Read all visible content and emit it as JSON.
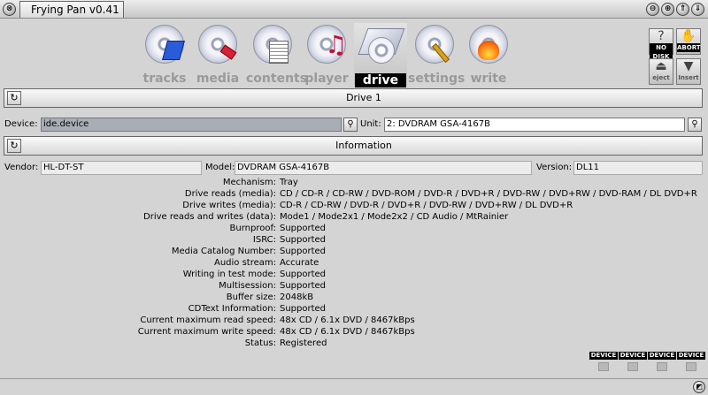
{
  "window": {
    "title": "Frying Pan v0.41"
  },
  "toolbar": {
    "tabs": [
      {
        "label": "tracks"
      },
      {
        "label": "media"
      },
      {
        "label": "contents"
      },
      {
        "label": "player"
      },
      {
        "label": "drive"
      },
      {
        "label": "settings"
      },
      {
        "label": "write"
      }
    ],
    "active": "drive",
    "buttons": {
      "no_disk": "NO DISK",
      "abort": "ABORT",
      "eject": "eject",
      "insert": "Insert"
    }
  },
  "drive_bar": {
    "title": "Drive 1"
  },
  "device": {
    "label": "Device:",
    "value": "ide.device"
  },
  "unit": {
    "label": "Unit:",
    "value": "2: DVDRAM GSA-4167B"
  },
  "info_bar": {
    "title": "Information"
  },
  "vendor": {
    "label": "Vendor:",
    "value": "HL-DT-ST"
  },
  "model": {
    "label": "Model:",
    "value": "DVDRAM GSA-4167B"
  },
  "version": {
    "label": "Version:",
    "value": "DL11"
  },
  "info_rows": [
    {
      "key": "Mechanism:",
      "value": "Tray"
    },
    {
      "key": "Drive reads (media):",
      "value": "CD / CD-R / CD-RW / DVD-ROM / DVD-R / DVD+R / DVD-RW / DVD+RW / DVD-RAM / DL DVD+R"
    },
    {
      "key": "Drive writes (media):",
      "value": "CD-R / CD-RW / DVD-R / DVD+R / DVD-RW / DVD+RW / DL DVD+R"
    },
    {
      "key": "Drive reads and writes (data):",
      "value": "Mode1 / Mode2x1 / Mode2x2 / CD Audio / MtRainier"
    },
    {
      "key": "Burnproof:",
      "value": "Supported"
    },
    {
      "key": "ISRC:",
      "value": "Supported"
    },
    {
      "key": "Media Catalog Number:",
      "value": "Supported"
    },
    {
      "key": "Audio stream:",
      "value": "Accurate"
    },
    {
      "key": "Writing in test mode:",
      "value": "Supported"
    },
    {
      "key": "Multisession:",
      "value": "Supported"
    },
    {
      "key": "Buffer size:",
      "value": "2048kB"
    },
    {
      "key": "CDText Information:",
      "value": "Supported"
    },
    {
      "key": "Current maximum read speed:",
      "value": "48x CD / 6.1x DVD / 8467kBps"
    },
    {
      "key": "Current maximum write speed:",
      "value": "48x CD / 6.1x DVD / 8467kBps"
    },
    {
      "key": "Status:",
      "value": "Registered"
    }
  ],
  "device_indicators": [
    "DEVICE",
    "DEVICE",
    "DEVICE",
    "DEVICE"
  ],
  "colors": {
    "active_tab_label_bg": "#000000",
    "inactive_label": "#9a9a9a",
    "device_field_bg": "#a8adb6"
  },
  "icons": {
    "close": "close-icon",
    "refresh": "refresh-icon",
    "popup": "magnifier-icon",
    "eject": "eject-icon",
    "insert": "insert-icon",
    "resize": "resize-icon"
  }
}
